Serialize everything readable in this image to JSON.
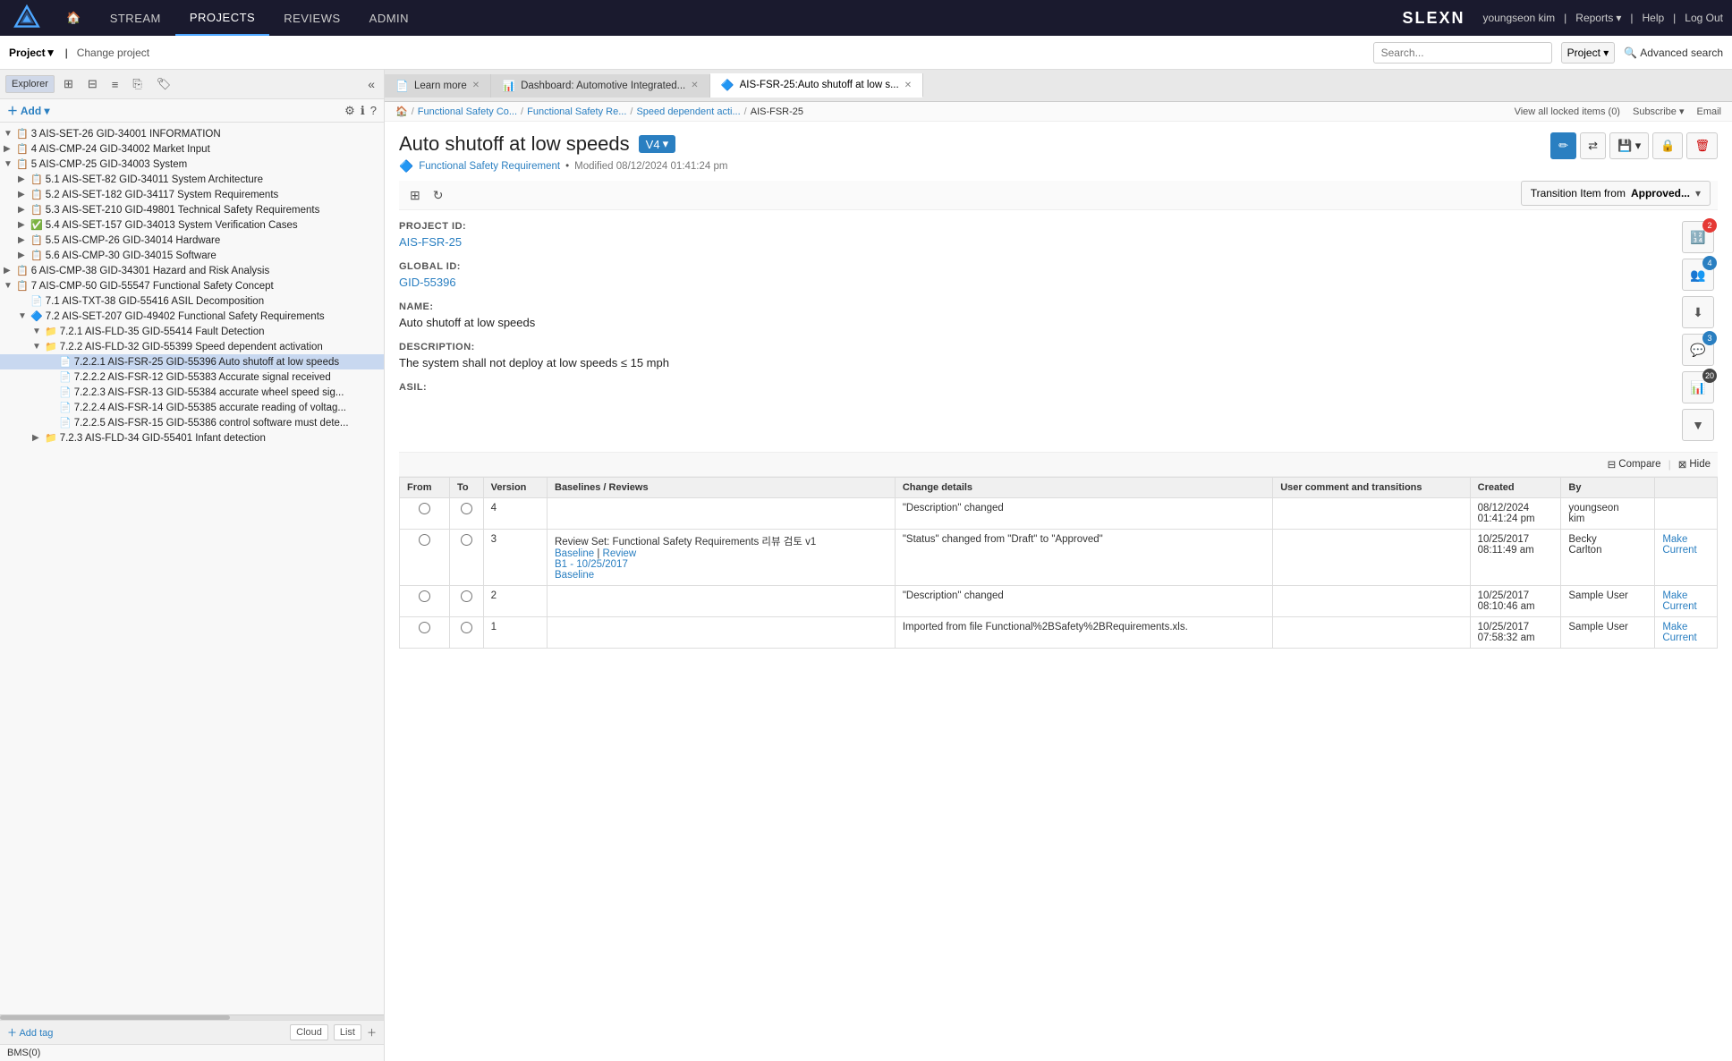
{
  "app": {
    "logo_alt": "Almworks logo",
    "brand": "SLEXN"
  },
  "topnav": {
    "home_label": "🏠",
    "items": [
      {
        "label": "STREAM",
        "active": false
      },
      {
        "label": "PROJECTS",
        "active": true
      },
      {
        "label": "REVIEWS",
        "active": false
      },
      {
        "label": "ADMIN",
        "active": false
      }
    ],
    "user": "youngseon kim",
    "reports": "Reports",
    "help": "Help",
    "logout": "Log Out"
  },
  "secondary_bar": {
    "project_label": "Project▼",
    "change_project": "Change project",
    "search_placeholder": "Search...",
    "search_type": "Project",
    "advanced_search": "Advanced search"
  },
  "sidebar": {
    "explorer_label": "Explorer",
    "add_label": "＋ Add ▾",
    "bms_label": "BMS(0)",
    "add_tag_label": "＋ Add tag",
    "cloud_label": "Cloud",
    "list_label": "List",
    "tree_items": [
      {
        "level": 0,
        "expanded": true,
        "icon": "📋",
        "text": "3 AIS-SET-26 GID-34001 INFORMATION"
      },
      {
        "level": 0,
        "expanded": false,
        "icon": "📋",
        "text": "4 AIS-CMP-24 GID-34002 Market Input"
      },
      {
        "level": 0,
        "expanded": true,
        "icon": "📋",
        "text": "5 AIS-CMP-25 GID-34003 System"
      },
      {
        "level": 1,
        "expanded": false,
        "icon": "📋",
        "text": "5.1 AIS-SET-82 GID-34011 System Architecture"
      },
      {
        "level": 1,
        "expanded": false,
        "icon": "📋",
        "text": "5.2 AIS-SET-182 GID-34117 System Requirements"
      },
      {
        "level": 1,
        "expanded": false,
        "icon": "📋",
        "text": "5.3 AIS-SET-210 GID-49801 Technical Safety Requirements"
      },
      {
        "level": 1,
        "expanded": false,
        "icon": "✅",
        "text": "5.4 AIS-SET-157 GID-34013 System Verification Cases"
      },
      {
        "level": 1,
        "expanded": false,
        "icon": "📋",
        "text": "5.5 AIS-CMP-26 GID-34014 Hardware"
      },
      {
        "level": 1,
        "expanded": false,
        "icon": "📋",
        "text": "5.6 AIS-CMP-30 GID-34015 Software"
      },
      {
        "level": 0,
        "expanded": false,
        "icon": "📋",
        "text": "6 AIS-CMP-38 GID-34301 Hazard and Risk Analysis"
      },
      {
        "level": 0,
        "expanded": true,
        "icon": "📋",
        "text": "7 AIS-CMP-50 GID-55547 Functional Safety Concept"
      },
      {
        "level": 1,
        "expanded": false,
        "icon": "📄",
        "text": "7.1 AIS-TXT-38 GID-55416 ASIL Decomposition"
      },
      {
        "level": 1,
        "expanded": true,
        "icon": "🔷",
        "text": "7.2 AIS-SET-207 GID-49402 Functional Safety Requirements"
      },
      {
        "level": 2,
        "expanded": true,
        "icon": "📁",
        "text": "7.2.1 AIS-FLD-35 GID-55414 Fault Detection"
      },
      {
        "level": 2,
        "expanded": true,
        "icon": "📁",
        "text": "7.2.2 AIS-FLD-32 GID-55399 Speed dependent activation"
      },
      {
        "level": 3,
        "expanded": false,
        "icon": "📄",
        "text": "7.2.2.1 AIS-FSR-25 GID-55396 Auto shutoff at low speeds",
        "selected": true
      },
      {
        "level": 3,
        "expanded": false,
        "icon": "📄",
        "text": "7.2.2.2 AIS-FSR-12 GID-55383 Accurate signal received"
      },
      {
        "level": 3,
        "expanded": false,
        "icon": "📄",
        "text": "7.2.2.3 AIS-FSR-13 GID-55384 accurate wheel speed sig..."
      },
      {
        "level": 3,
        "expanded": false,
        "icon": "📄",
        "text": "7.2.2.4 AIS-FSR-14 GID-55385 accurate reading of voltag..."
      },
      {
        "level": 3,
        "expanded": false,
        "icon": "📄",
        "text": "7.2.2.5 AIS-FSR-15 GID-55386 control software must dete..."
      },
      {
        "level": 2,
        "expanded": false,
        "icon": "📁",
        "text": "7.2.3 AIS-FLD-34 GID-55401 Infant detection"
      }
    ]
  },
  "tabs": [
    {
      "label": "Learn more",
      "icon": "📄",
      "active": false,
      "closeable": true
    },
    {
      "label": "Dashboard: Automotive Integrated...",
      "icon": "📊",
      "active": false,
      "closeable": true
    },
    {
      "label": "AIS-FSR-25:Auto shutoff at low s...",
      "icon": "🔷",
      "active": true,
      "closeable": true
    }
  ],
  "breadcrumb": {
    "items": [
      "🏠",
      "Functional Safety Co...",
      "Functional Safety Re...",
      "Speed dependent acti...",
      "AIS-FSR-25"
    ]
  },
  "item": {
    "title": "Auto shutoff at low speeds",
    "version": "V4",
    "type": "Functional Safety Requirement",
    "modified": "Modified 08/12/2024 01:41:24 pm",
    "project_id_label": "PROJECT ID:",
    "project_id_value": "AIS-FSR-25",
    "global_id_label": "GLOBAL ID:",
    "global_id_value": "GID-55396",
    "name_label": "NAME:",
    "name_value": "Auto shutoff at low speeds",
    "description_label": "DESCRIPTION:",
    "description_value": "The system shall not deploy at low speeds ≤ 15 mph",
    "asil_label": "ASIL:",
    "transition_label": "Transition Item from",
    "transition_status": "Approved...",
    "view_locked": "View all locked items (0)",
    "subscribe": "Subscribe ▾",
    "email": "Email"
  },
  "right_panel": {
    "badge1": "2",
    "badge2": "4",
    "badge3": "3",
    "badge4": "20"
  },
  "history": {
    "compare_label": "Compare",
    "hide_label": "Hide",
    "columns": [
      "From",
      "To",
      "Version",
      "Baselines / Reviews",
      "Change details",
      "User comment and transitions",
      "Created",
      "By",
      ""
    ],
    "rows": [
      {
        "from": "",
        "to": "",
        "version": "4",
        "baselines_reviews": "",
        "change_details": "\"Description\" changed",
        "user_comment": "",
        "created": "08/12/2024\n01:41:24 pm",
        "by": "youngseon\nkim",
        "action": ""
      },
      {
        "from": "",
        "to": "",
        "version": "3",
        "baselines_reviews": "Review Set: Functional Safety Requirements 리뷰 검토 v1\nBaseline | Review\nB1 - 10/25/2017\nBaseline",
        "change_details": "\"Status\" changed from \"Draft\" to \"Approved\"",
        "user_comment": "",
        "created": "10/25/2017\n08:11:49 am",
        "by": "Becky\nCarlton",
        "action": "Make\nCurrent"
      },
      {
        "from": "",
        "to": "",
        "version": "2",
        "baselines_reviews": "",
        "change_details": "\"Description\" changed",
        "user_comment": "",
        "created": "10/25/2017\n08:10:46 am",
        "by": "Sample User",
        "action": "Make\nCurrent"
      },
      {
        "from": "",
        "to": "",
        "version": "1",
        "baselines_reviews": "",
        "change_details": "Imported from file Functional%2BSafety%2BRequirements.xls.",
        "user_comment": "",
        "created": "10/25/2017\n07:58:32 am",
        "by": "Sample User",
        "action": "Make\nCurrent"
      }
    ]
  }
}
